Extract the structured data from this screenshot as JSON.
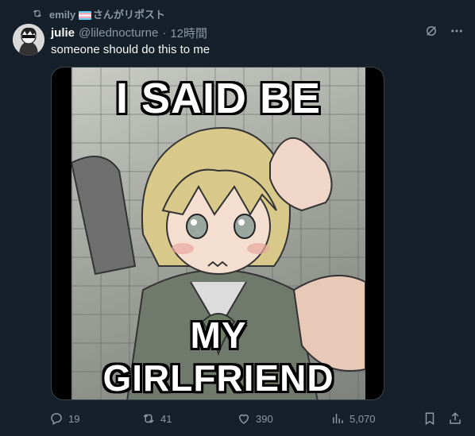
{
  "repost": {
    "user": "emily",
    "flag_icon": "transgender-flag-emoji",
    "text": "さんがリポスト"
  },
  "tweet": {
    "display_name": "julie",
    "handle": "@lilednocturne",
    "separator": "·",
    "time": "12時間",
    "text": "someone should do this to me"
  },
  "media": {
    "caption_top": "I SAID BE",
    "caption_bottom": "MY GIRLFRIEND"
  },
  "actions": {
    "replies": "19",
    "reposts": "41",
    "likes": "390",
    "views": "5,070"
  },
  "colors": {
    "background": "#15202b",
    "secondary_text": "#8b98a5",
    "primary_text": "#f7f9f9"
  }
}
